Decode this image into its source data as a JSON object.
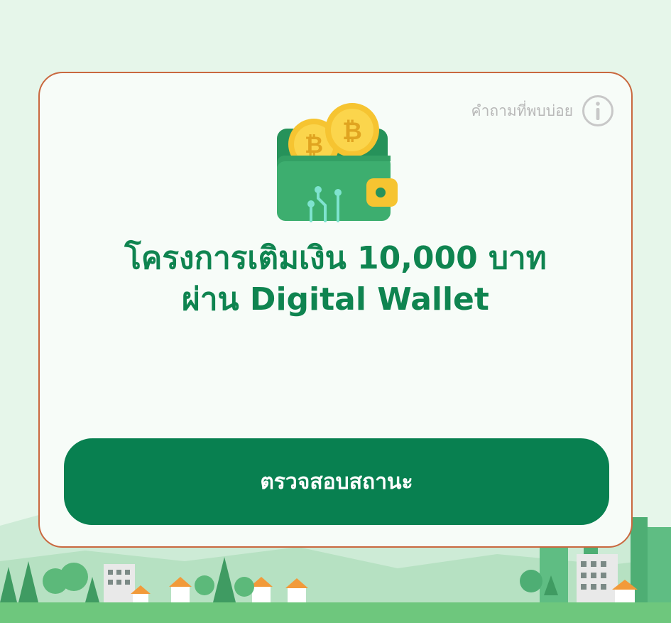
{
  "faq": {
    "label": "คำถามที่พบบ่อย",
    "icon": "info-icon"
  },
  "hero": {
    "icon": "bitcoin-wallet-icon"
  },
  "title": {
    "line1": "โครงการเติมเงิน 10,000 บาท",
    "line2": "ผ่าน Digital Wallet"
  },
  "button": {
    "label": "ตรวจสอบสถานะ"
  },
  "colors": {
    "brand_green": "#088050",
    "title_green": "#0f8450",
    "card_border": "#c9683f",
    "background": "#e6f6ea"
  }
}
